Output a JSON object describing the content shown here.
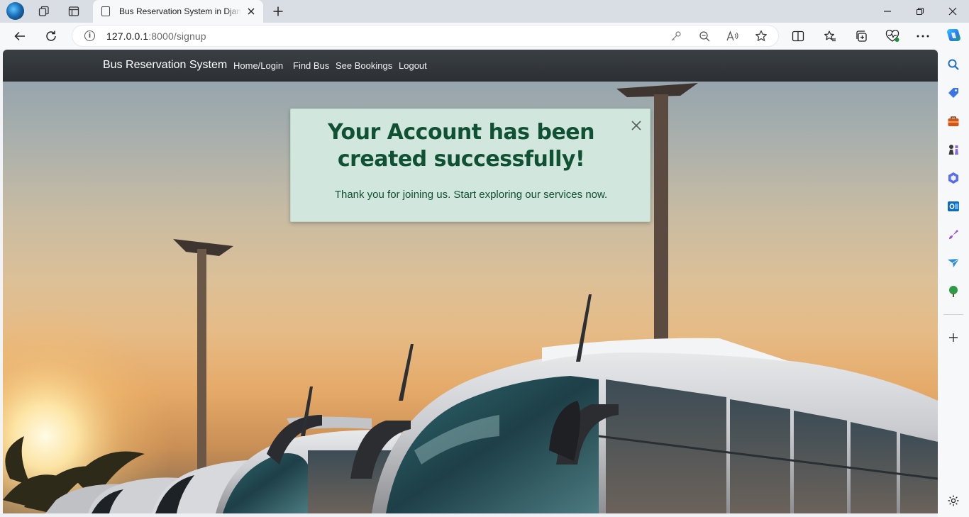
{
  "browser": {
    "tab": {
      "title": "Bus Reservation System in Django"
    },
    "address_bar": {
      "host": "127.0.0.1",
      "path": ":8000/signup"
    },
    "icons": {
      "profile": "profile-avatar-icon",
      "workspaces": "workspaces-icon",
      "tab_actions": "vertical-tabs-icon",
      "page": "page-icon",
      "close": "close-icon",
      "new_tab": "plus-icon",
      "minimize": "minimize-icon",
      "restore": "restore-icon",
      "back": "back-arrow-icon",
      "refresh": "refresh-icon",
      "info": "info-icon",
      "password": "key-icon",
      "zoom": "zoom-out-icon",
      "read_aloud": "read-aloud-icon",
      "favorite": "star-icon",
      "split": "split-screen-icon",
      "favorites": "favorites-icon",
      "collections": "collections-icon",
      "performance": "heart-pulse-icon",
      "more": "more-icon",
      "copilot": "copilot-icon"
    },
    "sidebar": [
      "search-icon",
      "tag-icon",
      "briefcase-icon",
      "chess-icon",
      "m365-icon",
      "outlook-icon",
      "designer-icon",
      "send-icon",
      "tree-icon",
      "add-icon",
      "settings-icon"
    ]
  },
  "site": {
    "brand": "Bus Reservation System",
    "nav": [
      "Home/Login",
      "Find Bus",
      "See Bookings",
      "Logout"
    ]
  },
  "alert": {
    "heading": "Your Account has been created successfully!",
    "message": "Thank you for joining us. Start exploring our services now."
  },
  "colors": {
    "navbar": "#343a40",
    "alert_bg": "#d1e7dd",
    "alert_text": "#0f5132"
  }
}
